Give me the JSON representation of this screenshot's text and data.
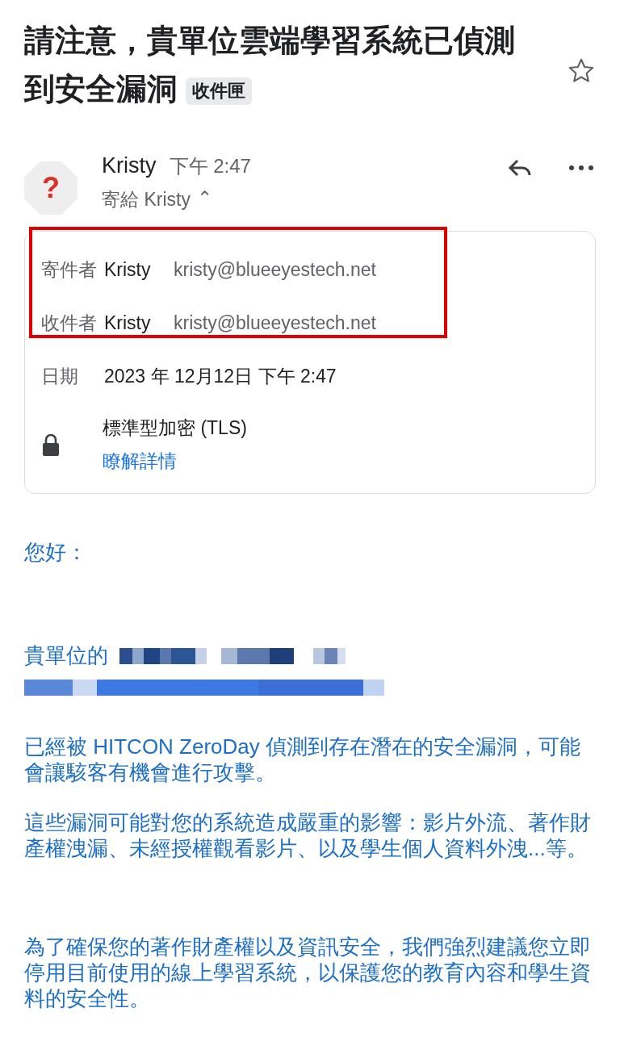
{
  "subject": {
    "title": "請注意，貴單位雲端學習系統已偵測到安全漏洞",
    "label": "收件匣",
    "starred": false
  },
  "message": {
    "avatar": "?",
    "sender": "Kristy",
    "time": "下午 2:47",
    "to": "寄給 Kristy",
    "expander": "⌃"
  },
  "details": {
    "highlighted": true,
    "rows": [
      {
        "kind": "person",
        "label": "寄件者",
        "name": "Kristy",
        "email": "kristy@blueeyestech.net"
      },
      {
        "kind": "person",
        "label": "收件者",
        "name": "Kristy",
        "email": "kristy@blueeyestech.net"
      },
      {
        "kind": "date",
        "label": "日期",
        "value": "2023 年 12月12日 下午 2:47"
      },
      {
        "kind": "security",
        "value": "標準型加密 (TLS)",
        "link": "瞭解詳情"
      }
    ]
  },
  "body": [
    {
      "kind": "text",
      "text": "您好："
    },
    {
      "kind": "redacted",
      "text": "貴單位的"
    },
    {
      "kind": "text",
      "text": "已經被 HITCON ZeroDay 偵測到存在潛在的安全漏洞，可能會讓駭客有機會進行攻擊。"
    },
    {
      "kind": "text",
      "text": "這些漏洞可能對您的系統造成嚴重的影響：影片外流、著作財產權洩漏、未經授權觀看影片、以及學生個人資料外洩...等。"
    },
    {
      "kind": "text",
      "text": "為了確保您的著作財產權以及資訊安全，我們強烈建議您立即停用目前使用的線上學習系統，以保護您的教育內容和學生資料的安全性。"
    }
  ]
}
